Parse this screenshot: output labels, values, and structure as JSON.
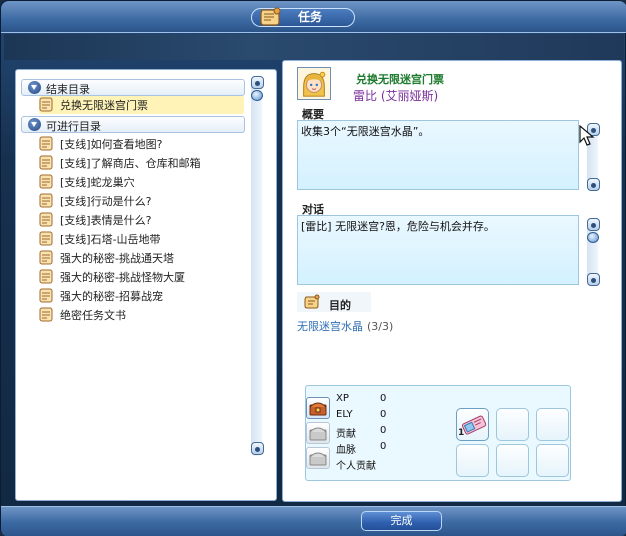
{
  "window": {
    "title": "任务"
  },
  "quest_list": {
    "categories": [
      {
        "label": "结束目录"
      },
      {
        "label": "可进行目录"
      }
    ],
    "completed_items": [
      {
        "label": "兑换无限迷宫门票",
        "selected": true
      }
    ],
    "available_items": [
      {
        "label": "[支线]如何查看地图?"
      },
      {
        "label": "[支线]了解商店、仓库和邮箱"
      },
      {
        "label": "[支线]蛇龙巢穴"
      },
      {
        "label": "[支线]行动是什么?"
      },
      {
        "label": "[支线]表情是什么?"
      },
      {
        "label": "[支线]石塔-山岳地带"
      },
      {
        "label": "强大的秘密-挑战通天塔"
      },
      {
        "label": "强大的秘密-挑战怪物大厦"
      },
      {
        "label": "强大的秘密-招募战宠"
      },
      {
        "label": "绝密任务文书"
      }
    ]
  },
  "detail": {
    "quest_name": "兑换无限迷宫门票",
    "npc_name": "雷比 (艾丽娅斯)",
    "summary_label": "概要",
    "summary_text": "收集3个“无限迷宫水晶”。",
    "dialog_label": "对话",
    "dialog_text": "[雷比] 无限迷宫?恩，危险与机会并存。",
    "purpose_label": "目的",
    "purpose_item": "无限迷宫水晶",
    "purpose_count": "(3/3)"
  },
  "rewards": {
    "rows": [
      {
        "label": "XP",
        "value": "0"
      },
      {
        "label": "ELY",
        "value": "0"
      },
      {
        "label": "贡献",
        "value": "0"
      },
      {
        "label": "血脉",
        "value": "0"
      },
      {
        "label": "个人贡献",
        "value": ""
      }
    ],
    "item_slot_count": "1"
  },
  "footer": {
    "complete_label": "完成"
  },
  "colors": {
    "accent": "#2e5fae",
    "quest_name": "#1b7a2c",
    "npc_name": "#7b2f9a",
    "purpose_item": "#2e6fb4"
  }
}
